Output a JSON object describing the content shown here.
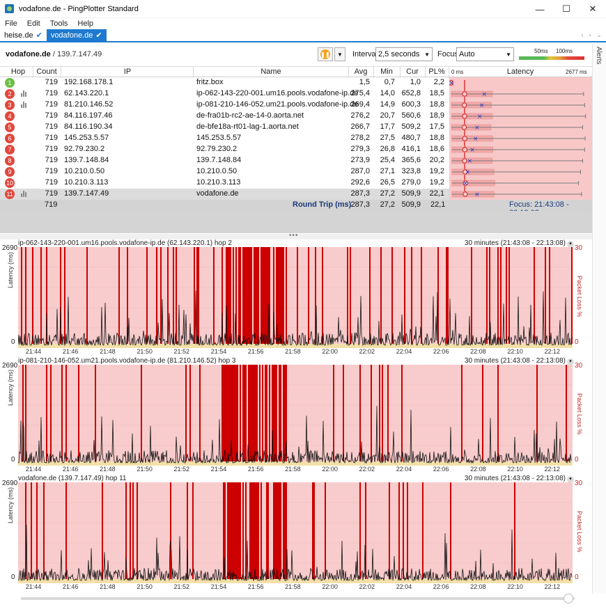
{
  "window": {
    "title": "vodafone.de - PingPlotter Standard",
    "minimize": "—",
    "maximize": "☐",
    "close": "✕"
  },
  "menu": [
    "File",
    "Edit",
    "Tools",
    "Help"
  ],
  "tabs": [
    {
      "label": "heise.de",
      "active": false
    },
    {
      "label": "vodafone.de",
      "active": true
    }
  ],
  "toolbar": {
    "target_name": "vodafone.de",
    "target_ip": " / 139.7.147.49",
    "interval_label": "Interval",
    "interval_value": "2,5 seconds",
    "focus_label": "Focus",
    "focus_value": "Auto",
    "scale_low": "50ms",
    "scale_high": "100ms"
  },
  "alerts_label": "Alerts",
  "table": {
    "headers": {
      "hop": "Hop",
      "count": "Count",
      "ip": "IP",
      "name": "Name",
      "avg": "Avg",
      "min": "Min",
      "cur": "Cur",
      "pl": "PL%",
      "latency_min": "0 ms",
      "latency": "Latency",
      "latency_max": "2677 ms"
    },
    "rows": [
      {
        "hop": "1",
        "count": "719",
        "ip": "192.168.178.1",
        "name": "fritz.box",
        "avg": "1,5",
        "min": "0,7",
        "cur": "1,0",
        "pl": "2,2",
        "avg_ms": 1.5,
        "min_ms": 0.7,
        "cur_ms": 1.0,
        "max_ms": 40,
        "status": "green",
        "graphed": false
      },
      {
        "hop": "2",
        "count": "719",
        "ip": "62.143.220.1",
        "name": "ip-062-143-220-001.um16.pools.vodafone-ip.de",
        "avg": "275,4",
        "min": "14,0",
        "cur": "652,8",
        "pl": "18,5",
        "avg_ms": 275.4,
        "min_ms": 14.0,
        "cur_ms": 652.8,
        "max_ms": 2620,
        "status": "red",
        "graphed": true
      },
      {
        "hop": "3",
        "count": "719",
        "ip": "81.210.146.52",
        "name": "ip-081-210-146-052.um21.pools.vodafone-ip.de",
        "avg": "269,4",
        "min": "14,9",
        "cur": "600,3",
        "pl": "18,8",
        "avg_ms": 269.4,
        "min_ms": 14.9,
        "cur_ms": 600.3,
        "max_ms": 2640,
        "status": "red",
        "graphed": true
      },
      {
        "hop": "4",
        "count": "719",
        "ip": "84.116.197.46",
        "name": "de-fra01b-rc2-ae-14-0.aorta.net",
        "avg": "276,2",
        "min": "20,7",
        "cur": "560,6",
        "pl": "18,9",
        "avg_ms": 276.2,
        "min_ms": 20.7,
        "cur_ms": 560.6,
        "max_ms": 2660,
        "status": "red",
        "graphed": false
      },
      {
        "hop": "5",
        "count": "719",
        "ip": "84.116.190.34",
        "name": "de-bfe18a-rt01-lag-1.aorta.net",
        "avg": "266,7",
        "min": "17,7",
        "cur": "509,2",
        "pl": "17,5",
        "avg_ms": 266.7,
        "min_ms": 17.7,
        "cur_ms": 509.2,
        "max_ms": 2600,
        "status": "red",
        "graphed": false
      },
      {
        "hop": "6",
        "count": "719",
        "ip": "145.253.5.57",
        "name": "145.253.5.57",
        "avg": "278,2",
        "min": "27,5",
        "cur": "480,7",
        "pl": "18,8",
        "avg_ms": 278.2,
        "min_ms": 27.5,
        "cur_ms": 480.7,
        "max_ms": 2650,
        "status": "red",
        "graphed": false
      },
      {
        "hop": "7",
        "count": "719",
        "ip": "92.79.230.2",
        "name": "92.79.230.2",
        "avg": "279,3",
        "min": "26,8",
        "cur": "416,1",
        "pl": "18,6",
        "avg_ms": 279.3,
        "min_ms": 26.8,
        "cur_ms": 416.1,
        "max_ms": 2640,
        "status": "red",
        "graphed": false
      },
      {
        "hop": "8",
        "count": "719",
        "ip": "139.7.148.84",
        "name": "139.7.148.84",
        "avg": "273,9",
        "min": "25,4",
        "cur": "365,6",
        "pl": "20,2",
        "avg_ms": 273.9,
        "min_ms": 25.4,
        "cur_ms": 365.6,
        "max_ms": 2600,
        "status": "red",
        "graphed": false
      },
      {
        "hop": "9",
        "count": "719",
        "ip": "10.210.0.50",
        "name": "10.210.0.50",
        "avg": "287,0",
        "min": "27,1",
        "cur": "323,8",
        "pl": "19,2",
        "avg_ms": 287.0,
        "min_ms": 27.1,
        "cur_ms": 323.8,
        "max_ms": 2560,
        "status": "red",
        "graphed": false
      },
      {
        "hop": "10",
        "count": "719",
        "ip": "10.210.3.113",
        "name": "10.210.3.113",
        "avg": "292,6",
        "min": "26,5",
        "cur": "279,0",
        "pl": "19,2",
        "avg_ms": 292.6,
        "min_ms": 26.5,
        "cur_ms": 279.0,
        "max_ms": 2520,
        "status": "red",
        "graphed": false
      },
      {
        "hop": "11",
        "count": "719",
        "ip": "139.7.147.49",
        "name": "vodafone.de",
        "avg": "287,3",
        "min": "27,2",
        "cur": "509,9",
        "pl": "22,1",
        "avg_ms": 287.3,
        "min_ms": 27.2,
        "cur_ms": 509.9,
        "max_ms": 2580,
        "status": "red",
        "graphed": true
      }
    ],
    "summary": {
      "count": "719",
      "label": "Round Trip (ms)",
      "avg": "287,3",
      "min": "27,2",
      "cur": "509,9",
      "pl": "22,1",
      "focus": "Focus: 21:43:08 - 22:13:08"
    }
  },
  "graphs": [
    {
      "title": "ip-062-143-220-001.um16.pools.vodafone-ip.de (62.143.220.1) hop 2",
      "range": "30 minutes (21:43:08 - 22:13:08)",
      "y_max": "2690",
      "y_min": "0",
      "y_label": "Latency (ms)",
      "r_max": "30",
      "r_min": "0",
      "r_label": "Packet Loss %"
    },
    {
      "title": "ip-081-210-146-052.um21.pools.vodafone-ip.de (81.210.146.52) hop 3",
      "range": "30 minutes (21:43:08 - 22:13:08)",
      "y_max": "2690",
      "y_min": "0",
      "y_label": "Latency (ms)",
      "r_max": "30",
      "r_min": "0",
      "r_label": "Packet Loss %"
    },
    {
      "title": "vodafone.de (139.7.147.49) hop 11",
      "range": "30 minutes (21:43:08 - 22:13:08)",
      "y_max": "2690",
      "y_min": "0",
      "y_label": "Latency (ms)",
      "r_max": "30",
      "r_min": "0",
      "r_label": "Packet Loss %"
    }
  ],
  "x_ticks": [
    "21:44",
    "21:46",
    "21:48",
    "21:50",
    "21:52",
    "21:54",
    "21:56",
    "21:58",
    "22:00",
    "22:02",
    "22:04",
    "22:06",
    "22:08",
    "22:10",
    "22:12"
  ],
  "colors": {
    "accent": "#1e7ad0",
    "loss": "#c40000",
    "loss_bg": "#f8c8c8",
    "hop_ok": "#6cbf45",
    "hop_bad": "#e0473c"
  }
}
